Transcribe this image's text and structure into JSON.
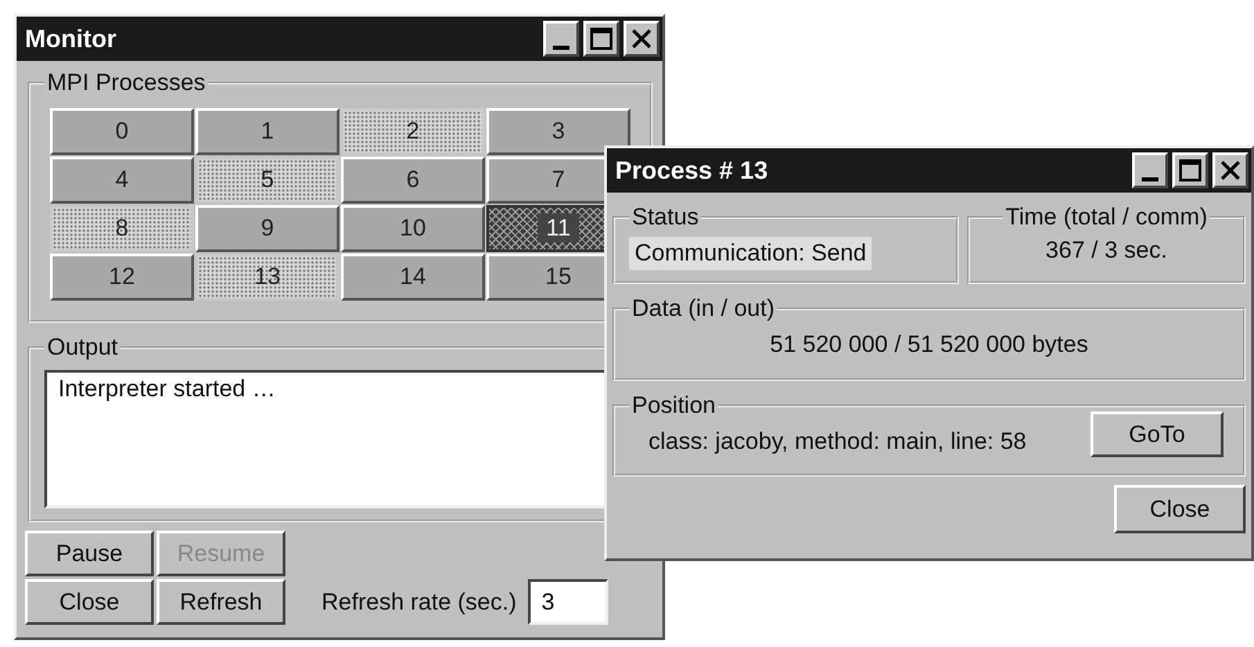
{
  "monitor": {
    "title": "Monitor",
    "processes_group": {
      "legend": "MPI Processes",
      "processes": [
        {
          "label": "0",
          "kind": "plain"
        },
        {
          "label": "1",
          "kind": "plain"
        },
        {
          "label": "2",
          "kind": "dotted"
        },
        {
          "label": "3",
          "kind": "plain"
        },
        {
          "label": "4",
          "kind": "plain"
        },
        {
          "label": "5",
          "kind": "dotted"
        },
        {
          "label": "6",
          "kind": "plain"
        },
        {
          "label": "7",
          "kind": "plain"
        },
        {
          "label": "8",
          "kind": "dotted"
        },
        {
          "label": "9",
          "kind": "plain"
        },
        {
          "label": "10",
          "kind": "plain"
        },
        {
          "label": "11",
          "kind": "hatched"
        },
        {
          "label": "12",
          "kind": "plain"
        },
        {
          "label": "13",
          "kind": "dotted"
        },
        {
          "label": "14",
          "kind": "plain"
        },
        {
          "label": "15",
          "kind": "plain"
        }
      ]
    },
    "output_group": {
      "legend": "Output",
      "text": "Interpreter started …"
    },
    "buttons": [
      {
        "label": "Pause",
        "disabled": false
      },
      {
        "label": "Resume",
        "disabled": true
      },
      {
        "label": "Close",
        "disabled": false
      },
      {
        "label": "Refresh",
        "disabled": false
      }
    ],
    "refresh_rate": {
      "label": "Refresh rate (sec.)",
      "value": "3"
    }
  },
  "process_window": {
    "title": "Process # 13",
    "status": {
      "legend": "Status",
      "value": "Communication: Send"
    },
    "time": {
      "legend": "Time (total / comm)",
      "value": "367 / 3 sec."
    },
    "data": {
      "legend": "Data (in / out)",
      "value": "51 520 000 / 51 520 000 bytes"
    },
    "position": {
      "legend": "Position",
      "value": "class: jacoby, method: main, line: 58",
      "button": "GoTo"
    },
    "close_button": "Close"
  }
}
